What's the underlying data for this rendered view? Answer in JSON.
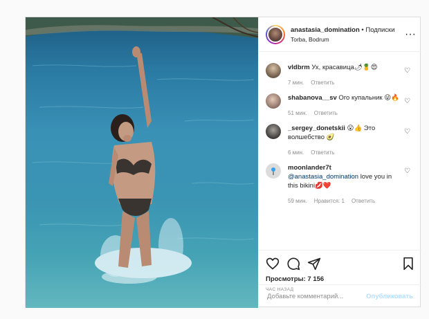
{
  "post": {
    "username": "anastasia_domination",
    "separator": "•",
    "follow_label": "Подписки",
    "location": "Torba, Bodrum",
    "more_label": "···"
  },
  "comments": [
    {
      "user": "vldbrm",
      "text": "Ух, красавица🌶🍍😍",
      "time": "7 мин.",
      "reply": "Ответить",
      "likes": ""
    },
    {
      "user": "shabanova__sv",
      "text": "Ого купальник 😜🔥",
      "time": "51 мин.",
      "reply": "Ответить",
      "likes": ""
    },
    {
      "user": "_sergey_donetskii",
      "text": "😮👍 Это волшебство 🥑",
      "time": "6 мин.",
      "reply": "Ответить",
      "likes": ""
    },
    {
      "user": "moonlander7t",
      "mention": "@anastasia_domination",
      "text": " love you in this bikini💋❤️",
      "time": "59 мин.",
      "likes": "Нравится: 1",
      "reply": "Ответить"
    }
  ],
  "stats": {
    "views_label": "Просмотры: 7 156",
    "time_label": "ЧАС НАЗАД"
  },
  "comment_box": {
    "placeholder": "Добавьте комментарий...",
    "publish_label": "Опубликовать"
  },
  "icons": [
    "heart-icon",
    "comment-icon",
    "share-icon",
    "bookmark-icon"
  ],
  "colors": {
    "link": "#00376b",
    "publish": "#b2dffc",
    "muted": "#8e8e8e"
  }
}
